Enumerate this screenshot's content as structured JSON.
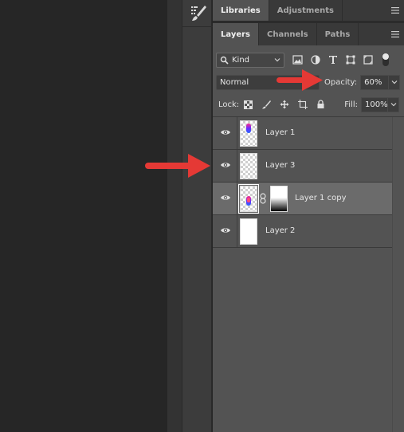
{
  "panel_tabs_top": {
    "libraries": "Libraries",
    "adjustments": "Adjustments"
  },
  "panel_tabs": {
    "layers": "Layers",
    "channels": "Channels",
    "paths": "Paths"
  },
  "filter": {
    "kind_label": "Kind",
    "icons": [
      "image-filter-icon",
      "adjustment-filter-icon",
      "type-filter-icon",
      "shape-filter-icon",
      "smart-object-filter-icon",
      "filter-toggle"
    ]
  },
  "blend": {
    "mode": "Normal",
    "opacity_label": "Opacity:",
    "opacity_value": "60%"
  },
  "lock": {
    "label": "Lock:",
    "icons": [
      "lock-transparent-icon",
      "lock-image-icon",
      "lock-position-icon",
      "lock-artboard-icon",
      "lock-all-icon"
    ],
    "fill_label": "Fill:",
    "fill_value": "100%"
  },
  "layers": [
    {
      "name": "Layer 1",
      "visible": true,
      "selected": false,
      "thumb": "art"
    },
    {
      "name": "Layer 3",
      "visible": true,
      "selected": false,
      "thumb": "transparent"
    },
    {
      "name": "Layer 1 copy",
      "visible": true,
      "selected": true,
      "thumb": "art",
      "has_mask": true
    },
    {
      "name": "Layer 2",
      "visible": true,
      "selected": false,
      "thumb": "white"
    }
  ],
  "colors": {
    "panel_bg": "#535353",
    "selected_row": "#6b6b6b",
    "arrow": "#e53935"
  }
}
